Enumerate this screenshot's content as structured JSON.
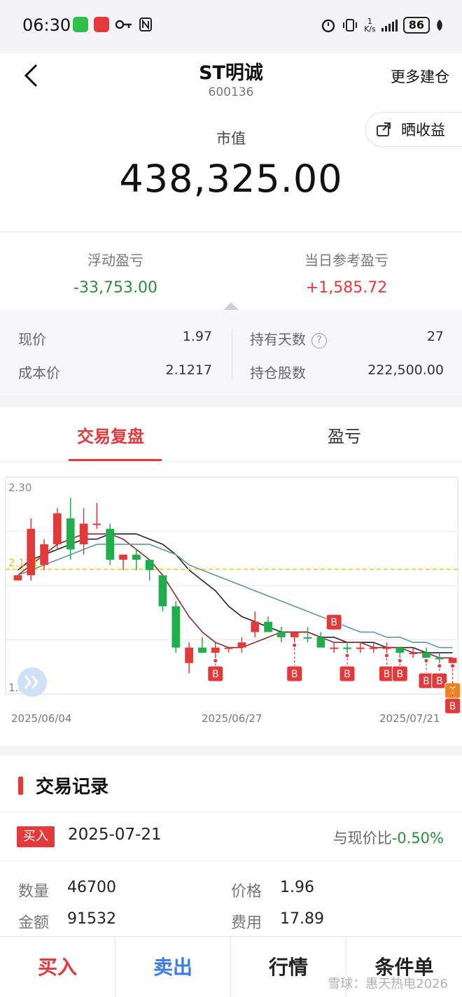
{
  "status_bar": {
    "time": "06:30",
    "net_speed_num": "1",
    "net_speed_unit": "K/s",
    "battery": "86"
  },
  "header": {
    "title": "ST明诚",
    "code": "600136",
    "more_label": "更多建仓",
    "share_label": "晒收益"
  },
  "market_value": {
    "label": "市值",
    "value": "438,325.00"
  },
  "pnl": {
    "floating_label": "浮动盈亏",
    "floating_value": "-33,753.00",
    "daily_label": "当日参考盈亏",
    "daily_value": "+1,585.72"
  },
  "info": {
    "price_label": "现价",
    "price_value": "1.97",
    "cost_label": "成本价",
    "cost_value": "2.1217",
    "days_label": "持有天数",
    "days_value": "27",
    "shares_label": "持仓股数",
    "shares_value": "222,500.00"
  },
  "tabs": [
    {
      "label": "交易复盘",
      "active": true
    },
    {
      "label": "盈亏",
      "active": false
    }
  ],
  "chart_data": {
    "type": "candlestick",
    "y_top_label": "2.30",
    "y_bottom_label": "1.88",
    "ylim": [
      1.88,
      2.3
    ],
    "cost_line_label": "2.1217",
    "cost_line_value": 2.1217,
    "x_labels": [
      "2025/06/04",
      "2025/06/27",
      "2025/07/21"
    ],
    "candles": [
      {
        "o": 2.1,
        "h": 2.11,
        "l": 2.1,
        "c": 2.11,
        "color": "red"
      },
      {
        "o": 2.11,
        "h": 2.22,
        "l": 2.1,
        "c": 2.2,
        "color": "red"
      },
      {
        "o": 2.13,
        "h": 2.18,
        "l": 2.12,
        "c": 2.17,
        "color": "red"
      },
      {
        "o": 2.17,
        "h": 2.24,
        "l": 2.16,
        "c": 2.23,
        "color": "red"
      },
      {
        "o": 2.22,
        "h": 2.26,
        "l": 2.14,
        "c": 2.16,
        "color": "green"
      },
      {
        "o": 2.17,
        "h": 2.24,
        "l": 2.15,
        "c": 2.21,
        "color": "red"
      },
      {
        "o": 2.21,
        "h": 2.25,
        "l": 2.2,
        "c": 2.21,
        "color": "red"
      },
      {
        "o": 2.2,
        "h": 2.21,
        "l": 2.13,
        "c": 2.14,
        "color": "green"
      },
      {
        "o": 2.14,
        "h": 2.15,
        "l": 2.12,
        "c": 2.15,
        "color": "red"
      },
      {
        "o": 2.15,
        "h": 2.16,
        "l": 2.12,
        "c": 2.14,
        "color": "green"
      },
      {
        "o": 2.14,
        "h": 2.14,
        "l": 2.1,
        "c": 2.12,
        "color": "green"
      },
      {
        "o": 2.11,
        "h": 2.11,
        "l": 2.04,
        "c": 2.05,
        "color": "green"
      },
      {
        "o": 2.05,
        "h": 2.06,
        "l": 1.96,
        "c": 1.97,
        "color": "green"
      },
      {
        "o": 1.94,
        "h": 1.98,
        "l": 1.92,
        "c": 1.97,
        "color": "red"
      },
      {
        "o": 1.97,
        "h": 1.99,
        "l": 1.96,
        "c": 1.96,
        "color": "green"
      },
      {
        "o": 1.96,
        "h": 1.98,
        "l": 1.95,
        "c": 1.97,
        "color": "red"
      },
      {
        "o": 1.97,
        "h": 1.97,
        "l": 1.96,
        "c": 1.97,
        "color": "red"
      },
      {
        "o": 1.97,
        "h": 1.99,
        "l": 1.96,
        "c": 1.98,
        "color": "red"
      },
      {
        "o": 2.0,
        "h": 2.04,
        "l": 1.99,
        "c": 2.02,
        "color": "red"
      },
      {
        "o": 2.02,
        "h": 2.03,
        "l": 2.0,
        "c": 2.0,
        "color": "green"
      },
      {
        "o": 2.0,
        "h": 2.01,
        "l": 1.98,
        "c": 1.99,
        "color": "green"
      },
      {
        "o": 1.99,
        "h": 2.0,
        "l": 1.98,
        "c": 2.0,
        "color": "red"
      },
      {
        "o": 1.99,
        "h": 2.01,
        "l": 1.98,
        "c": 1.99,
        "color": "green"
      },
      {
        "o": 1.99,
        "h": 2.0,
        "l": 1.97,
        "c": 1.97,
        "color": "green"
      },
      {
        "o": 1.97,
        "h": 1.98,
        "l": 1.96,
        "c": 1.97,
        "color": "red"
      },
      {
        "o": 1.97,
        "h": 1.98,
        "l": 1.96,
        "c": 1.97,
        "color": "green"
      },
      {
        "o": 1.97,
        "h": 1.98,
        "l": 1.96,
        "c": 1.97,
        "color": "red"
      },
      {
        "o": 1.97,
        "h": 1.98,
        "l": 1.96,
        "c": 1.97,
        "color": "red"
      },
      {
        "o": 1.97,
        "h": 1.98,
        "l": 1.96,
        "c": 1.97,
        "color": "red"
      },
      {
        "o": 1.97,
        "h": 1.97,
        "l": 1.95,
        "c": 1.96,
        "color": "green"
      },
      {
        "o": 1.96,
        "h": 1.97,
        "l": 1.95,
        "c": 1.96,
        "color": "red"
      },
      {
        "o": 1.96,
        "h": 1.97,
        "l": 1.95,
        "c": 1.95,
        "color": "green"
      },
      {
        "o": 1.95,
        "h": 1.96,
        "l": 1.94,
        "c": 1.95,
        "color": "green"
      },
      {
        "o": 1.95,
        "h": 1.95,
        "l": 1.94,
        "c": 1.94,
        "color": "red"
      }
    ],
    "ma_lines": [
      {
        "color": "#222222",
        "values": [
          2.12,
          2.14,
          2.15,
          2.16,
          2.17,
          2.18,
          2.18,
          2.19,
          2.19,
          2.19,
          2.18,
          2.17,
          2.15,
          2.12,
          2.1,
          2.08,
          2.05,
          2.03,
          2.02,
          2.01,
          2.0,
          2.0,
          2.0,
          1.99,
          1.99,
          1.98,
          1.98,
          1.98,
          1.97,
          1.97,
          1.97,
          1.96,
          1.96,
          1.96
        ]
      },
      {
        "color": "#8b2a2a",
        "values": [
          2.11,
          2.13,
          2.15,
          2.17,
          2.18,
          2.19,
          2.19,
          2.19,
          2.18,
          2.16,
          2.14,
          2.11,
          2.07,
          2.03,
          2.0,
          1.98,
          1.97,
          1.97,
          1.98,
          1.99,
          2.0,
          2.0,
          2.0,
          1.99,
          1.98,
          1.98,
          1.98,
          1.97,
          1.97,
          1.97,
          1.96,
          1.96,
          1.95,
          1.95
        ]
      },
      {
        "color": "#5a9a9a",
        "values": [
          2.11,
          2.12,
          2.13,
          2.14,
          2.15,
          2.16,
          2.17,
          2.17,
          2.17,
          2.17,
          2.17,
          2.16,
          2.15,
          2.13,
          2.12,
          2.11,
          2.1,
          2.09,
          2.08,
          2.07,
          2.06,
          2.05,
          2.04,
          2.03,
          2.02,
          2.01,
          2.0,
          2.0,
          1.99,
          1.99,
          1.98,
          1.98,
          1.97,
          1.97
        ]
      }
    ],
    "markers": [
      {
        "index": 15,
        "label": "B",
        "kind": "buy-below"
      },
      {
        "index": 21,
        "label": "B",
        "kind": "buy-below"
      },
      {
        "index": 24,
        "label": "B",
        "kind": "buy-above"
      },
      {
        "index": 25,
        "label": "B",
        "kind": "buy-below"
      },
      {
        "index": 28,
        "label": "B",
        "kind": "buy-below"
      },
      {
        "index": 29,
        "label": "B",
        "kind": "buy-below"
      },
      {
        "index": 31,
        "label": "B",
        "kind": "buy-low"
      },
      {
        "index": 32,
        "label": "B",
        "kind": "buy-low"
      },
      {
        "index": 33,
        "label": "T",
        "kind": "t-low"
      },
      {
        "index": 33,
        "label": "B",
        "kind": "buy-lower"
      }
    ]
  },
  "records": {
    "title": "交易记录",
    "entry": {
      "type_label": "买入",
      "date": "2025-07-21",
      "compare_label": "与现价比",
      "compare_value": "-0.50%",
      "qty_label": "数量",
      "qty_value": "46700",
      "price_label": "价格",
      "price_value": "1.96",
      "amount_label": "金额",
      "amount_value": "91532",
      "fee_label": "费用",
      "fee_value": "17.89"
    }
  },
  "bottom_bar": {
    "buy": "买入",
    "sell": "卖出",
    "quote": "行情",
    "conditional": "条件单"
  },
  "watermark": "雪球：惠天热电2026",
  "colors": {
    "accent_red": "#e23a3a",
    "green": "#2e8b3e",
    "blue": "#3b7be8",
    "candle_red": "#e23a3a",
    "candle_green": "#1fae4b",
    "cost_line": "#e6c619",
    "marker_orange": "#f0821e"
  }
}
